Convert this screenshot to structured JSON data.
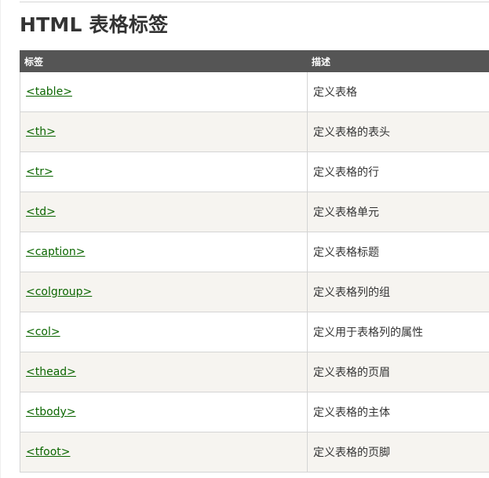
{
  "title": "HTML 表格标签",
  "table": {
    "headers": [
      "标签",
      "描述"
    ],
    "rows": [
      {
        "tag": "<table>",
        "desc": "定义表格"
      },
      {
        "tag": "<th>",
        "desc": "定义表格的表头"
      },
      {
        "tag": "<tr>",
        "desc": "定义表格的行"
      },
      {
        "tag": "<td>",
        "desc": "定义表格单元"
      },
      {
        "tag": "<caption>",
        "desc": "定义表格标题"
      },
      {
        "tag": "<colgroup>",
        "desc": "定义表格列的组"
      },
      {
        "tag": "<col>",
        "desc": "定义用于表格列的属性"
      },
      {
        "tag": "<thead>",
        "desc": "定义表格的页眉"
      },
      {
        "tag": "<tbody>",
        "desc": "定义表格的主体"
      },
      {
        "tag": "<tfoot>",
        "desc": "定义表格的页脚"
      }
    ]
  },
  "colors": {
    "header_bg": "#555555",
    "link": "#0b6600",
    "alt_row_bg": "#f6f4f0",
    "title": "#333333"
  }
}
